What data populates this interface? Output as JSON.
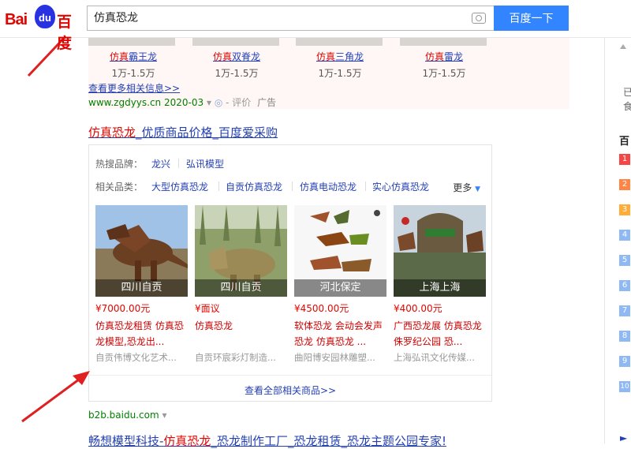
{
  "header": {
    "logo_text_1": "Bai",
    "logo_paw_text": "du",
    "logo_text_2": "百度",
    "search_query": "仿真恐龙",
    "search_button": "百度一下"
  },
  "promo": {
    "items": [
      {
        "name_red": "仿真",
        "name_rest": "霸王龙",
        "price": "1万-1.5万"
      },
      {
        "name_red": "仿真",
        "name_rest": "双脊龙",
        "price": "1万-1.5万"
      },
      {
        "name_red": "仿真",
        "name_rest": "三角龙",
        "price": "1万-1.5万"
      },
      {
        "name_red": "仿真",
        "name_rest": "雷龙",
        "price": "1万-1.5万"
      }
    ],
    "more_link": "查看更多相关信息>>",
    "source_url": "www.zgdyys.cn",
    "source_date": "2020-03",
    "review": "- 评价",
    "ad": "广告"
  },
  "result2": {
    "title_red": "仿真恐龙",
    "title_rest": "_优质商品价格_百度爱采购",
    "brand_label": "热搜品牌：",
    "brands": [
      "龙兴",
      "弘讯模型"
    ],
    "category_label": "相关品类：",
    "categories": [
      "大型仿真恐龙",
      "自贡仿真恐龙",
      "仿真电动恐龙",
      "实心仿真恐龙"
    ],
    "more": "更多",
    "products": [
      {
        "location": "四川自贡",
        "price": "¥7000.00元",
        "desc": "仿真恐龙租赁 仿真恐龙模型,恐龙出...",
        "shop": "自贡伟博文化艺术..."
      },
      {
        "location": "四川自贡",
        "price": "¥面议",
        "desc": "仿真恐龙",
        "shop": "自贡环宸彩灯制造..."
      },
      {
        "location": "河北保定",
        "price": "¥4500.00元",
        "desc": "软体恐龙 会动会发声恐龙 仿真恐龙 ...",
        "shop": "曲阳博安园林雕塑..."
      },
      {
        "location": "上海上海",
        "price": "¥400.00元",
        "desc": "广西恐龙展 仿真恐龙侏罗纪公园 恐...",
        "shop": "上海弘讯文化传媒..."
      }
    ],
    "all_goods": "查看全部相关商品>>",
    "source": "b2b.baidu.com"
  },
  "result3": {
    "title_pre": "畅想模型科技-",
    "title_red": "仿真恐龙",
    "title_rest": "_恐龙制作工厂_恐龙租赁_恐龙主题公园专家!"
  },
  "right_rail": {
    "frag_1": "已",
    "frag_2": "食",
    "hot_title": "百",
    "ranks": [
      "1",
      "2",
      "3",
      "4",
      "5",
      "6",
      "7",
      "8",
      "9",
      "10"
    ],
    "bottom": "►"
  },
  "colors": {
    "link": "#2440b3",
    "highlight": "#e10601",
    "source": "#008000",
    "button": "#3385ff",
    "arrow": "#e02020"
  }
}
